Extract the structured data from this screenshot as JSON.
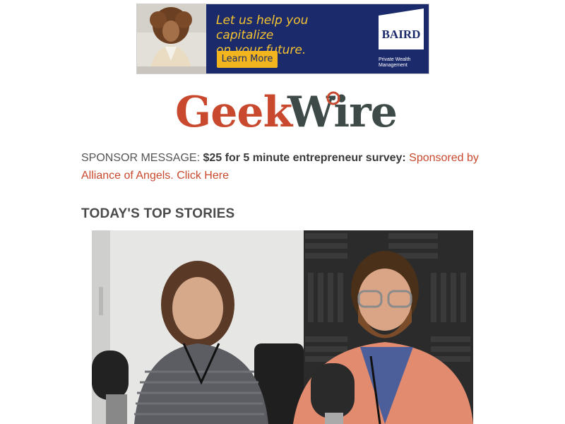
{
  "ad": {
    "headline_line1": "Let us help you capitalize",
    "headline_line2": "on your future.",
    "cta": "Learn More",
    "brand": "BAIRD",
    "brand_sub_line1": "Private Wealth",
    "brand_sub_line2": "Management",
    "colors": {
      "background": "#1b2a6b",
      "accent": "#f2b51d"
    }
  },
  "logo": {
    "part1": "Geek",
    "part2": "Wire",
    "colors": {
      "geek": "#c8492d",
      "wire": "#3d4a48"
    }
  },
  "sponsor": {
    "label": "SPONSOR MESSAGE:",
    "bold": "$25 for 5 minute entrepreneur survey:",
    "link_text": "Sponsored by Alliance of Angels. Click Here"
  },
  "section": {
    "title": "TODAY'S TOP STORIES"
  }
}
